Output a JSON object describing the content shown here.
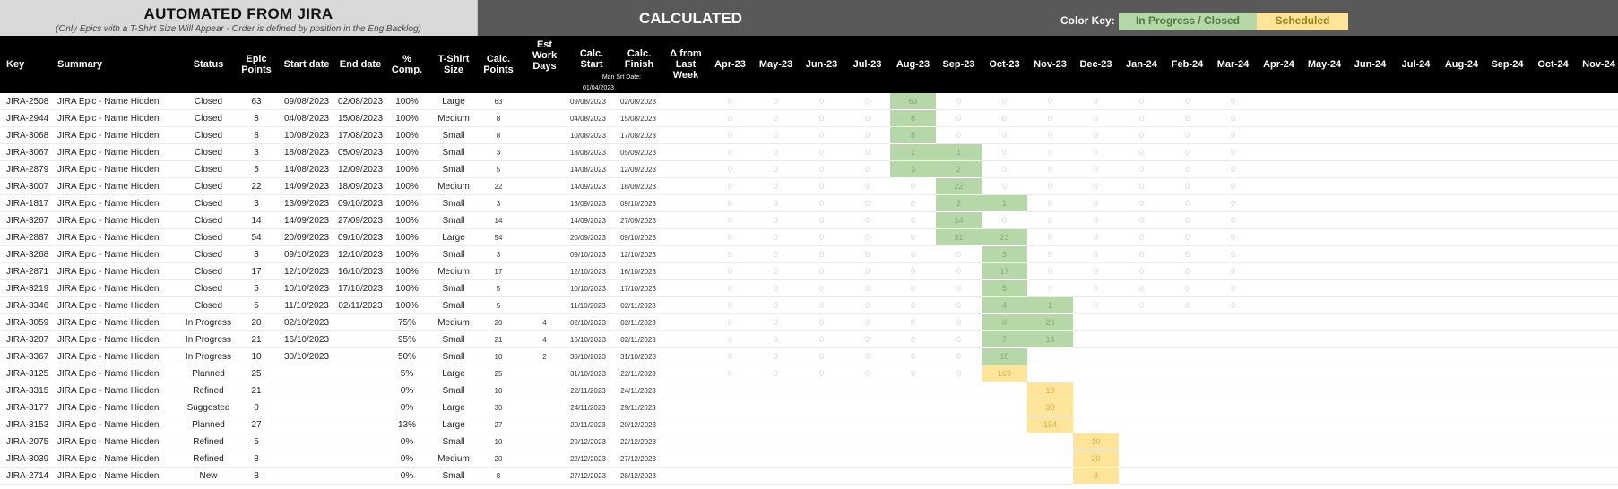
{
  "header": {
    "jira_title": "AUTOMATED FROM JIRA",
    "jira_subtitle": "(Only Epics with a T-Shirt Size Will Appear - Order is defined by position in the Eng Backlog)",
    "calc_title": "CALCULATED",
    "color_key_label": "Color Key:",
    "key_in_progress": "In Progress / Closed",
    "key_scheduled": "Scheduled"
  },
  "colors": {
    "in_progress": "#b6d7a8",
    "scheduled": "#ffe599",
    "header_bg": "#000000",
    "calc_bg": "#595959",
    "jira_bg": "#d9d9d9"
  },
  "columns": {
    "key": "Key",
    "summary": "Summary",
    "status": "Status",
    "epic_points": "Epic Points",
    "start": "Start date",
    "end": "End date",
    "pct": "% Comp.",
    "size": "T-Shirt Size",
    "calc_points": "Calc. Points",
    "work_days": "Est Work Days",
    "calc_start": "Calc. Start",
    "calc_finish": "Calc. Finish",
    "delta": "Δ from Last Week",
    "man_srt": "Man Srt Date:",
    "man_srt_value": "01/04/2023"
  },
  "months": [
    "Apr-23",
    "May-23",
    "Jun-23",
    "Jul-23",
    "Aug-23",
    "Sep-23",
    "Oct-23",
    "Nov-23",
    "Dec-23",
    "Jan-24",
    "Feb-24",
    "Mar-24",
    "Apr-24",
    "May-24",
    "Jun-24",
    "Jul-24",
    "Aug-24",
    "Sep-24",
    "Oct-24",
    "Nov-24"
  ],
  "rows": [
    {
      "key": "JIRA-2508",
      "summary": "JIRA Epic - Name Hidden",
      "status": "Closed",
      "epic_points": "63",
      "start": "09/08/2023",
      "end": "02/08/2023",
      "pct": "100%",
      "size": "Large",
      "calc_points": "63",
      "work_days": "",
      "calc_start": "09/08/2023",
      "calc_finish": "02/08/2023",
      "delta": "",
      "gantt": {
        "4": [
          "63",
          "g"
        ]
      },
      "zeros": 12
    },
    {
      "key": "JIRA-2944",
      "summary": "JIRA Epic - Name Hidden",
      "status": "Closed",
      "epic_points": "8",
      "start": "04/08/2023",
      "end": "15/08/2023",
      "pct": "100%",
      "size": "Medium",
      "calc_points": "8",
      "work_days": "",
      "calc_start": "04/08/2023",
      "calc_finish": "15/08/2023",
      "delta": "",
      "gantt": {
        "4": [
          "8",
          "g"
        ]
      },
      "zeros": 12
    },
    {
      "key": "JIRA-3068",
      "summary": "JIRA Epic - Name Hidden",
      "status": "Closed",
      "epic_points": "8",
      "start": "10/08/2023",
      "end": "17/08/2023",
      "pct": "100%",
      "size": "Small",
      "calc_points": "8",
      "work_days": "",
      "calc_start": "10/08/2023",
      "calc_finish": "17/08/2023",
      "delta": "",
      "gantt": {
        "4": [
          "8",
          "g"
        ]
      },
      "zeros": 12
    },
    {
      "key": "JIRA-3067",
      "summary": "JIRA Epic - Name Hidden",
      "status": "Closed",
      "epic_points": "3",
      "start": "18/08/2023",
      "end": "05/09/2023",
      "pct": "100%",
      "size": "Small",
      "calc_points": "3",
      "work_days": "",
      "calc_start": "18/08/2023",
      "calc_finish": "05/09/2023",
      "delta": "",
      "gantt": {
        "4": [
          "2",
          "g"
        ],
        "5": [
          "1",
          "g"
        ]
      },
      "zeros": 12
    },
    {
      "key": "JIRA-2879",
      "summary": "JIRA Epic - Name Hidden",
      "status": "Closed",
      "epic_points": "5",
      "start": "14/08/2023",
      "end": "12/09/2023",
      "pct": "100%",
      "size": "Small",
      "calc_points": "5",
      "work_days": "",
      "calc_start": "14/08/2023",
      "calc_finish": "12/09/2023",
      "delta": "",
      "gantt": {
        "4": [
          "3",
          "g"
        ],
        "5": [
          "2",
          "g"
        ]
      },
      "zeros": 12
    },
    {
      "key": "JIRA-3007",
      "summary": "JIRA Epic - Name Hidden",
      "status": "Closed",
      "epic_points": "22",
      "start": "14/09/2023",
      "end": "18/09/2023",
      "pct": "100%",
      "size": "Medium",
      "calc_points": "22",
      "work_days": "",
      "calc_start": "14/09/2023",
      "calc_finish": "18/09/2023",
      "delta": "",
      "gantt": {
        "5": [
          "22",
          "g"
        ]
      },
      "zeros": 12
    },
    {
      "key": "JIRA-1817",
      "summary": "JIRA Epic - Name Hidden",
      "status": "Closed",
      "epic_points": "3",
      "start": "13/09/2023",
      "end": "09/10/2023",
      "pct": "100%",
      "size": "Small",
      "calc_points": "3",
      "work_days": "",
      "calc_start": "13/09/2023",
      "calc_finish": "09/10/2023",
      "delta": "",
      "gantt": {
        "5": [
          "2",
          "g"
        ],
        "6": [
          "1",
          "g"
        ]
      },
      "zeros": 12
    },
    {
      "key": "JIRA-3267",
      "summary": "JIRA Epic - Name Hidden",
      "status": "Closed",
      "epic_points": "14",
      "start": "14/09/2023",
      "end": "27/09/2023",
      "pct": "100%",
      "size": "Small",
      "calc_points": "14",
      "work_days": "",
      "calc_start": "14/09/2023",
      "calc_finish": "27/09/2023",
      "delta": "",
      "gantt": {
        "5": [
          "14",
          "g"
        ]
      },
      "zeros": 12
    },
    {
      "key": "JIRA-2887",
      "summary": "JIRA Epic - Name Hidden",
      "status": "Closed",
      "epic_points": "54",
      "start": "20/09/2023",
      "end": "09/10/2023",
      "pct": "100%",
      "size": "Large",
      "calc_points": "54",
      "work_days": "",
      "calc_start": "20/09/2023",
      "calc_finish": "09/10/2023",
      "delta": "",
      "gantt": {
        "5": [
          "31",
          "g"
        ],
        "6": [
          "23",
          "g"
        ]
      },
      "zeros": 12
    },
    {
      "key": "JIRA-3268",
      "summary": "JIRA Epic - Name Hidden",
      "status": "Closed",
      "epic_points": "3",
      "start": "09/10/2023",
      "end": "12/10/2023",
      "pct": "100%",
      "size": "Small",
      "calc_points": "3",
      "work_days": "",
      "calc_start": "09/10/2023",
      "calc_finish": "12/10/2023",
      "delta": "",
      "gantt": {
        "6": [
          "3",
          "g"
        ]
      },
      "zeros": 12
    },
    {
      "key": "JIRA-2871",
      "summary": "JIRA Epic - Name Hidden",
      "status": "Closed",
      "epic_points": "17",
      "start": "12/10/2023",
      "end": "16/10/2023",
      "pct": "100%",
      "size": "Medium",
      "calc_points": "17",
      "work_days": "",
      "calc_start": "12/10/2023",
      "calc_finish": "16/10/2023",
      "delta": "",
      "gantt": {
        "6": [
          "17",
          "g"
        ]
      },
      "zeros": 12
    },
    {
      "key": "JIRA-3219",
      "summary": "JIRA Epic - Name Hidden",
      "status": "Closed",
      "epic_points": "5",
      "start": "10/10/2023",
      "end": "17/10/2023",
      "pct": "100%",
      "size": "Small",
      "calc_points": "5",
      "work_days": "",
      "calc_start": "10/10/2023",
      "calc_finish": "17/10/2023",
      "delta": "",
      "gantt": {
        "6": [
          "5",
          "g"
        ]
      },
      "zeros": 12
    },
    {
      "key": "JIRA-3346",
      "summary": "JIRA Epic - Name Hidden",
      "status": "Closed",
      "epic_points": "5",
      "start": "11/10/2023",
      "end": "02/11/2023",
      "pct": "100%",
      "size": "Small",
      "calc_points": "5",
      "work_days": "",
      "calc_start": "11/10/2023",
      "calc_finish": "02/11/2023",
      "delta": "",
      "gantt": {
        "6": [
          "4",
          "g"
        ],
        "7": [
          "1",
          "g"
        ]
      },
      "zeros": 12
    },
    {
      "key": "JIRA-3059",
      "summary": "JIRA Epic - Name Hidden",
      "status": "In Progress",
      "epic_points": "20",
      "start": "02/10/2023",
      "end": "",
      "pct": "75%",
      "size": "Medium",
      "calc_points": "20",
      "work_days": "4",
      "calc_start": "02/10/2023",
      "calc_finish": "02/11/2023",
      "delta": "",
      "gantt": {
        "6": [
          "0",
          "g"
        ],
        "7": [
          "20",
          "g"
        ]
      },
      "zeros": 8
    },
    {
      "key": "JIRA-3207",
      "summary": "JIRA Epic - Name Hidden",
      "status": "In Progress",
      "epic_points": "21",
      "start": "16/10/2023",
      "end": "",
      "pct": "95%",
      "size": "Small",
      "calc_points": "21",
      "work_days": "4",
      "calc_start": "16/10/2023",
      "calc_finish": "02/11/2023",
      "delta": "",
      "gantt": {
        "6": [
          "7",
          "g"
        ],
        "7": [
          "14",
          "g"
        ]
      },
      "zeros": 6
    },
    {
      "key": "JIRA-3367",
      "summary": "JIRA Epic - Name Hidden",
      "status": "In Progress",
      "epic_points": "10",
      "start": "30/10/2023",
      "end": "",
      "pct": "50%",
      "size": "Small",
      "calc_points": "10",
      "work_days": "2",
      "calc_start": "30/10/2023",
      "calc_finish": "31/10/2023",
      "delta": "",
      "gantt": {
        "6": [
          "10",
          "g"
        ]
      },
      "zeros": 6
    },
    {
      "key": "JIRA-3125",
      "summary": "JIRA Epic - Name Hidden",
      "status": "Planned",
      "epic_points": "25",
      "start": "",
      "end": "",
      "pct": "5%",
      "size": "Large",
      "calc_points": "25",
      "work_days": "",
      "calc_start": "31/10/2023",
      "calc_finish": "22/11/2023",
      "delta": "",
      "gantt": {
        "6": [
          "169",
          "y"
        ]
      },
      "zeros": 6
    },
    {
      "key": "JIRA-3315",
      "summary": "JIRA Epic - Name Hidden",
      "status": "Refined",
      "epic_points": "21",
      "start": "",
      "end": "",
      "pct": "0%",
      "size": "Small",
      "calc_points": "10",
      "work_days": "",
      "calc_start": "22/11/2023",
      "calc_finish": "24/11/2023",
      "delta": "",
      "gantt": {
        "7": [
          "10",
          "y"
        ]
      },
      "zeros": 0
    },
    {
      "key": "JIRA-3177",
      "summary": "JIRA Epic - Name Hidden",
      "status": "Suggested",
      "epic_points": "0",
      "start": "",
      "end": "",
      "pct": "0%",
      "size": "Large",
      "calc_points": "30",
      "work_days": "",
      "calc_start": "24/11/2023",
      "calc_finish": "29/11/2023",
      "delta": "",
      "gantt": {
        "7": [
          "30",
          "y"
        ]
      },
      "zeros": 0
    },
    {
      "key": "JIRA-3153",
      "summary": "JIRA Epic - Name Hidden",
      "status": "Planned",
      "epic_points": "27",
      "start": "",
      "end": "",
      "pct": "13%",
      "size": "Large",
      "calc_points": "27",
      "work_days": "",
      "calc_start": "29/11/2023",
      "calc_finish": "20/12/2023",
      "delta": "",
      "gantt": {
        "7": [
          "154",
          "y"
        ]
      },
      "zeros": 0
    },
    {
      "key": "JIRA-2075",
      "summary": "JIRA Epic - Name Hidden",
      "status": "Refined",
      "epic_points": "5",
      "start": "",
      "end": "",
      "pct": "0%",
      "size": "Small",
      "calc_points": "10",
      "work_days": "",
      "calc_start": "20/12/2023",
      "calc_finish": "22/12/2023",
      "delta": "",
      "gantt": {
        "8": [
          "10",
          "y"
        ]
      },
      "zeros": 0
    },
    {
      "key": "JIRA-3039",
      "summary": "JIRA Epic - Name Hidden",
      "status": "Refined",
      "epic_points": "8",
      "start": "",
      "end": "",
      "pct": "0%",
      "size": "Medium",
      "calc_points": "20",
      "work_days": "",
      "calc_start": "22/12/2023",
      "calc_finish": "27/12/2023",
      "delta": "",
      "gantt": {
        "8": [
          "20",
          "y"
        ]
      },
      "zeros": 0
    },
    {
      "key": "JIRA-2714",
      "summary": "JIRA Epic - Name Hidden",
      "status": "New",
      "epic_points": "8",
      "start": "",
      "end": "",
      "pct": "0%",
      "size": "Small",
      "calc_points": "8",
      "work_days": "",
      "calc_start": "27/12/2023",
      "calc_finish": "28/12/2023",
      "delta": "",
      "gantt": {
        "8": [
          "8",
          "y"
        ]
      },
      "zeros": 0
    }
  ]
}
